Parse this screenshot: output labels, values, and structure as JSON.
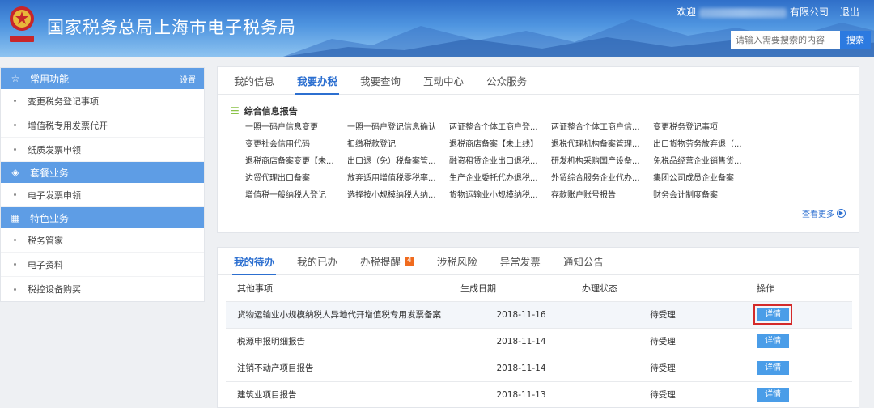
{
  "header": {
    "title": "国家税务总局上海市电子税务局",
    "welcome": "欢迎",
    "company_suffix": "有限公司",
    "logout": "退出",
    "search_placeholder": "请输入需要搜索的内容",
    "search_button": "搜索"
  },
  "sidebar": {
    "groups": [
      {
        "title": "常用功能",
        "icon": "star-icon",
        "setting": "设置",
        "items": [
          "变更税务登记事项",
          "增值税专用发票代开",
          "纸质发票申领"
        ]
      },
      {
        "title": "套餐业务",
        "icon": "layers-icon",
        "items": [
          "电子发票申领"
        ]
      },
      {
        "title": "特色业务",
        "icon": "grid-icon",
        "items": [
          "税务管家",
          "电子资料",
          "税控设备购买"
        ]
      }
    ]
  },
  "top_panel": {
    "tabs": [
      "我的信息",
      "我要办税",
      "我要查询",
      "互动中心",
      "公众服务"
    ],
    "active_tab": 1,
    "section_title": "综合信息报告",
    "links": [
      "一照一码户信息变更",
      "一照一码户登记信息确认",
      "两证整合个体工商户登...",
      "两证整合个体工商户信...",
      "变更税务登记事项",
      "变更社会信用代码",
      "扣缴税款登记",
      "退税商店备案【未上线】",
      "退税代理机构备案管理...",
      "出口货物劳务放弃退（...",
      "退税商店备案变更【未...",
      "出口退（免）税备案管...",
      "融资租赁企业出口退税...",
      "研发机构采购国产设备...",
      "免税品经营企业销售货...",
      "边贸代理出口备案",
      "放弃适用增值税零税率...",
      "生产企业委托代办退税...",
      "外贸综合服务企业代办...",
      "集团公司成员企业备案",
      "增值税一般纳税人登记",
      "选择按小规模纳税人纳...",
      "货物运输业小规模纳税...",
      "存款账户账号报告",
      "财务会计制度备案"
    ],
    "more": "查看更多"
  },
  "bottom_panel": {
    "tabs": [
      {
        "label": "我的待办"
      },
      {
        "label": "我的已办"
      },
      {
        "label": "办税提醒",
        "badge": "4"
      },
      {
        "label": "涉税风险"
      },
      {
        "label": "异常发票"
      },
      {
        "label": "通知公告"
      }
    ],
    "active_tab": 0,
    "columns": [
      "其他事项",
      "生成日期",
      "办理状态",
      "操作"
    ],
    "rows": [
      {
        "item": "货物运输业小规模纳税人异地代开增值税专用发票备案",
        "date": "2018-11-16",
        "status": "待受理",
        "action": "详情"
      },
      {
        "item": "税源申报明细报告",
        "date": "2018-11-14",
        "status": "待受理",
        "action": "详情"
      },
      {
        "item": "注销不动产项目报告",
        "date": "2018-11-14",
        "status": "待受理",
        "action": "详情"
      },
      {
        "item": "建筑业项目报告",
        "date": "2018-11-13",
        "status": "待受理",
        "action": "详情"
      }
    ]
  }
}
